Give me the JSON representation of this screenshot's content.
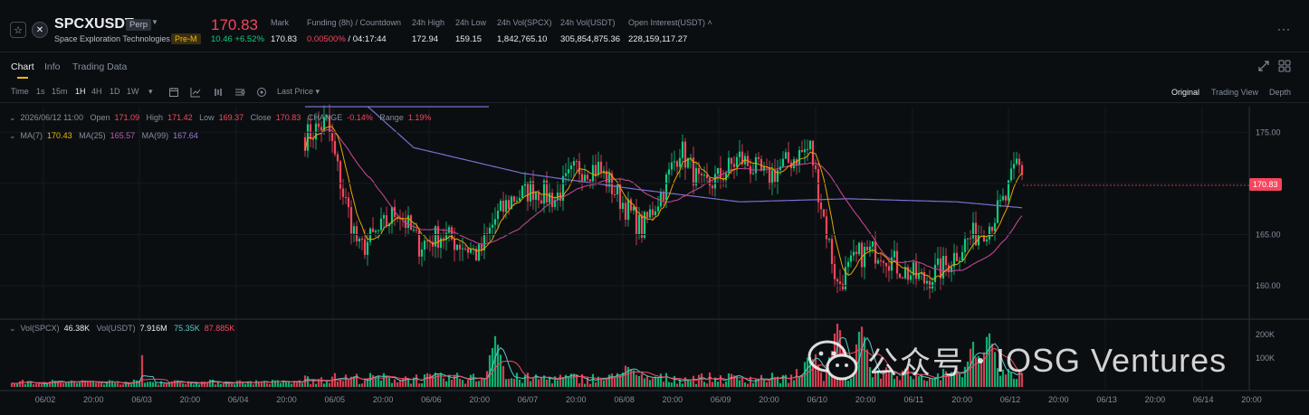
{
  "header": {
    "symbol": "SPCXUSDT",
    "contract_badge": "Perp",
    "full_name": "Space Exploration Technologies",
    "stage_badge": "Pre-M",
    "last_price": "170.83",
    "change": "10.46 +6.52%",
    "stats": [
      {
        "label": "Mark",
        "value": "170.83"
      },
      {
        "label": "Funding (8h) / Countdown",
        "value_red": "0.00500%",
        "value": " / 04:17:44"
      },
      {
        "label": "24h High",
        "value": "172.94"
      },
      {
        "label": "24h Low",
        "value": "159.15"
      },
      {
        "label": "24h Vol(SPCX)",
        "value": "1,842,765.10"
      },
      {
        "label": "24h Vol(USDT)",
        "value": "305,854,875.36"
      },
      {
        "label": "Open Interest(USDT)",
        "value": "228,159,117.27"
      }
    ],
    "colors": {
      "up": "#0ecb81",
      "down": "#f6465d",
      "accent": "#f0b90b"
    }
  },
  "tabs": [
    "Chart",
    "Info",
    "Trading Data"
  ],
  "toolbar": {
    "intervals": [
      "Time",
      "1s",
      "15m",
      "1H",
      "4H",
      "1D",
      "1W"
    ],
    "active_interval": "1H",
    "price_source": "Last Price",
    "views": [
      "Original",
      "Trading View",
      "Depth"
    ],
    "active_view": "Original",
    "icons": [
      "candle-type-icon",
      "indicator-icon",
      "compare-icon",
      "settings-icon",
      "template-icon"
    ]
  },
  "legend": {
    "ohlc": {
      "date": "2026/06/12 11:00",
      "open_label": "Open",
      "open": "171.09",
      "high_label": "High",
      "high": "171.42",
      "low_label": "Low",
      "low": "169.37",
      "close_label": "Close",
      "close": "170.83",
      "change_label": "CHANGE",
      "change": "-0.14%",
      "range_label": "Range",
      "range": "1.19%"
    },
    "ma": {
      "ma7_label": "MA(7)",
      "ma7": "170.43",
      "ma25_label": "MA(25)",
      "ma25": "165.57",
      "ma99_label": "MA(99)",
      "ma99": "167.64"
    },
    "vol": {
      "vol_spcx_label": "Vol(SPCX)",
      "vol_spcx": "46.38K",
      "vol_usdt_label": "Vol(USDT)",
      "vol_usdt": "7.916M",
      "ma_a": "75.35K",
      "ma_b": "87.885K"
    }
  },
  "chart_data": {
    "type": "candlestick",
    "price_axis_ticks": [
      "175.00",
      "170.00",
      "165.00",
      "160.00"
    ],
    "volume_axis_ticks": [
      "200K",
      "100K"
    ],
    "x_ticks": [
      "06/02",
      "20:00",
      "06/03",
      "20:00",
      "06/04",
      "20:00",
      "06/05",
      "20:00",
      "06/06",
      "20:00",
      "06/07",
      "20:00",
      "06/08",
      "20:00",
      "06/09",
      "20:00",
      "06/10",
      "20:00",
      "06/11",
      "20:00",
      "06/12",
      "20:00",
      "06/13",
      "20:00",
      "06/14",
      "20:00"
    ],
    "ylim": [
      157,
      177.5
    ],
    "last_price": "170.83",
    "close_path": [
      [
        0,
        174.5
      ],
      [
        8,
        176
      ],
      [
        14,
        169
      ],
      [
        20,
        163.5
      ],
      [
        28,
        165.5
      ],
      [
        34,
        167.5
      ],
      [
        42,
        164
      ],
      [
        50,
        165
      ],
      [
        58,
        164
      ],
      [
        64,
        163
      ],
      [
        70,
        166.5
      ],
      [
        76,
        168.5
      ],
      [
        84,
        169.5
      ],
      [
        92,
        168.5
      ],
      [
        100,
        171.5
      ],
      [
        108,
        171.5
      ],
      [
        116,
        168.5
      ],
      [
        124,
        165.5
      ],
      [
        132,
        169.5
      ],
      [
        138,
        173.5
      ],
      [
        146,
        169.5
      ],
      [
        152,
        170.5
      ],
      [
        160,
        172.5
      ],
      [
        170,
        170.5
      ],
      [
        180,
        172.5
      ],
      [
        186,
        173.5
      ],
      [
        190,
        168
      ],
      [
        196,
        160
      ],
      [
        204,
        163
      ],
      [
        212,
        163.5
      ],
      [
        220,
        161.5
      ],
      [
        228,
        160.5
      ],
      [
        236,
        162
      ],
      [
        244,
        164.5
      ],
      [
        252,
        166
      ],
      [
        258,
        168.5
      ],
      [
        262,
        172
      ],
      [
        265,
        170.83
      ]
    ],
    "candle_count": 265,
    "ma99_path": [
      [
        0,
        183
      ],
      [
        40,
        173.5
      ],
      [
        80,
        171
      ],
      [
        120,
        169.5
      ],
      [
        160,
        168.2
      ],
      [
        200,
        168.5
      ],
      [
        240,
        168.2
      ],
      [
        265,
        167.6
      ]
    ],
    "volume_spikes": [
      [
        70,
        160
      ],
      [
        118,
        48
      ],
      [
        187,
        70
      ],
      [
        196,
        190
      ],
      [
        205,
        178
      ],
      [
        246,
        95
      ],
      [
        252,
        140
      ]
    ]
  },
  "watermark": {
    "left": "公众号",
    "right": "IOSG Ventures"
  }
}
